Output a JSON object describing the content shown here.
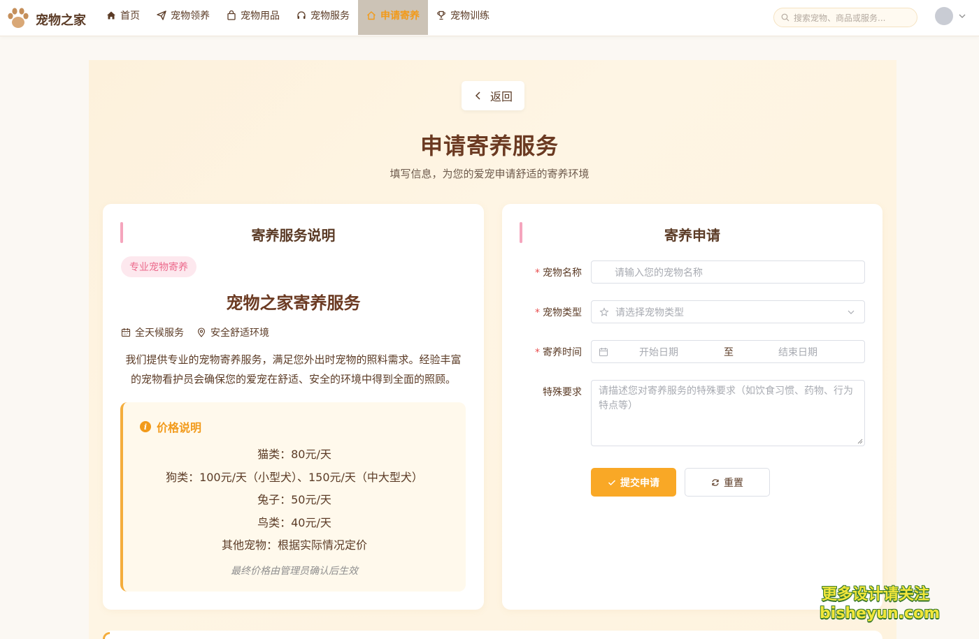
{
  "brand": {
    "name": "宠物之家",
    "logo_icon": "paw-icon"
  },
  "nav": {
    "items": [
      {
        "label": "首页",
        "icon": "home-icon"
      },
      {
        "label": "宠物领养",
        "icon": "send-icon"
      },
      {
        "label": "宠物用品",
        "icon": "bag-icon"
      },
      {
        "label": "宠物服务",
        "icon": "headset-icon"
      },
      {
        "label": "申请寄养",
        "icon": "house-icon",
        "active": true
      },
      {
        "label": "宠物训练",
        "icon": "trophy-icon"
      }
    ],
    "search_placeholder": "搜索宠物、商品或服务..."
  },
  "page": {
    "back_label": "返回",
    "title": "申请寄养服务",
    "subtitle": "填写信息，为您的爱宠申请舒适的寄养环境"
  },
  "info_card": {
    "title": "寄养服务说明",
    "tag": "专业宠物寄养",
    "service_title": "宠物之家寄养服务",
    "meta": [
      {
        "label": "全天候服务",
        "icon": "calendar-icon"
      },
      {
        "label": "安全舒适环境",
        "icon": "location-icon"
      }
    ],
    "description": "我们提供专业的宠物寄养服务，满足您外出时宠物的照料需求。经验丰富的宠物看护员会确保您的爱宠在舒适、安全的环境中得到全面的照顾。",
    "price": {
      "heading": "价格说明",
      "lines": [
        "猫类：80元/天",
        "狗类：100元/天（小型犬）、150元/天（中大型犬）",
        "兔子：50元/天",
        "鸟类：40元/天",
        "其他宠物：根据实际情况定价"
      ],
      "note": "最终价格由管理员确认后生效"
    }
  },
  "form_card": {
    "title": "寄养申请",
    "required_mark": "*",
    "fields": {
      "pet_name": {
        "label": "宠物名称",
        "placeholder": "请输入您的宠物名称"
      },
      "pet_type": {
        "label": "宠物类型",
        "placeholder": "请选择宠物类型"
      },
      "period": {
        "label": "寄养时间",
        "start_placeholder": "开始日期",
        "separator": "至",
        "end_placeholder": "结束日期"
      },
      "special": {
        "label": "特殊要求",
        "placeholder": "请描述您对寄养服务的特殊要求（如饮食习惯、药物、行为特点等）"
      }
    },
    "submit_label": "提交申请",
    "reset_label": "重置"
  },
  "watermark": {
    "line1": "更多设计请关注",
    "line2": "bisheyun.com"
  },
  "colors": {
    "accent": "#f9a826",
    "brand_brown": "#6b3a22",
    "active_nav_bg": "#ccc3b6",
    "pink": "#f5a5bd"
  }
}
